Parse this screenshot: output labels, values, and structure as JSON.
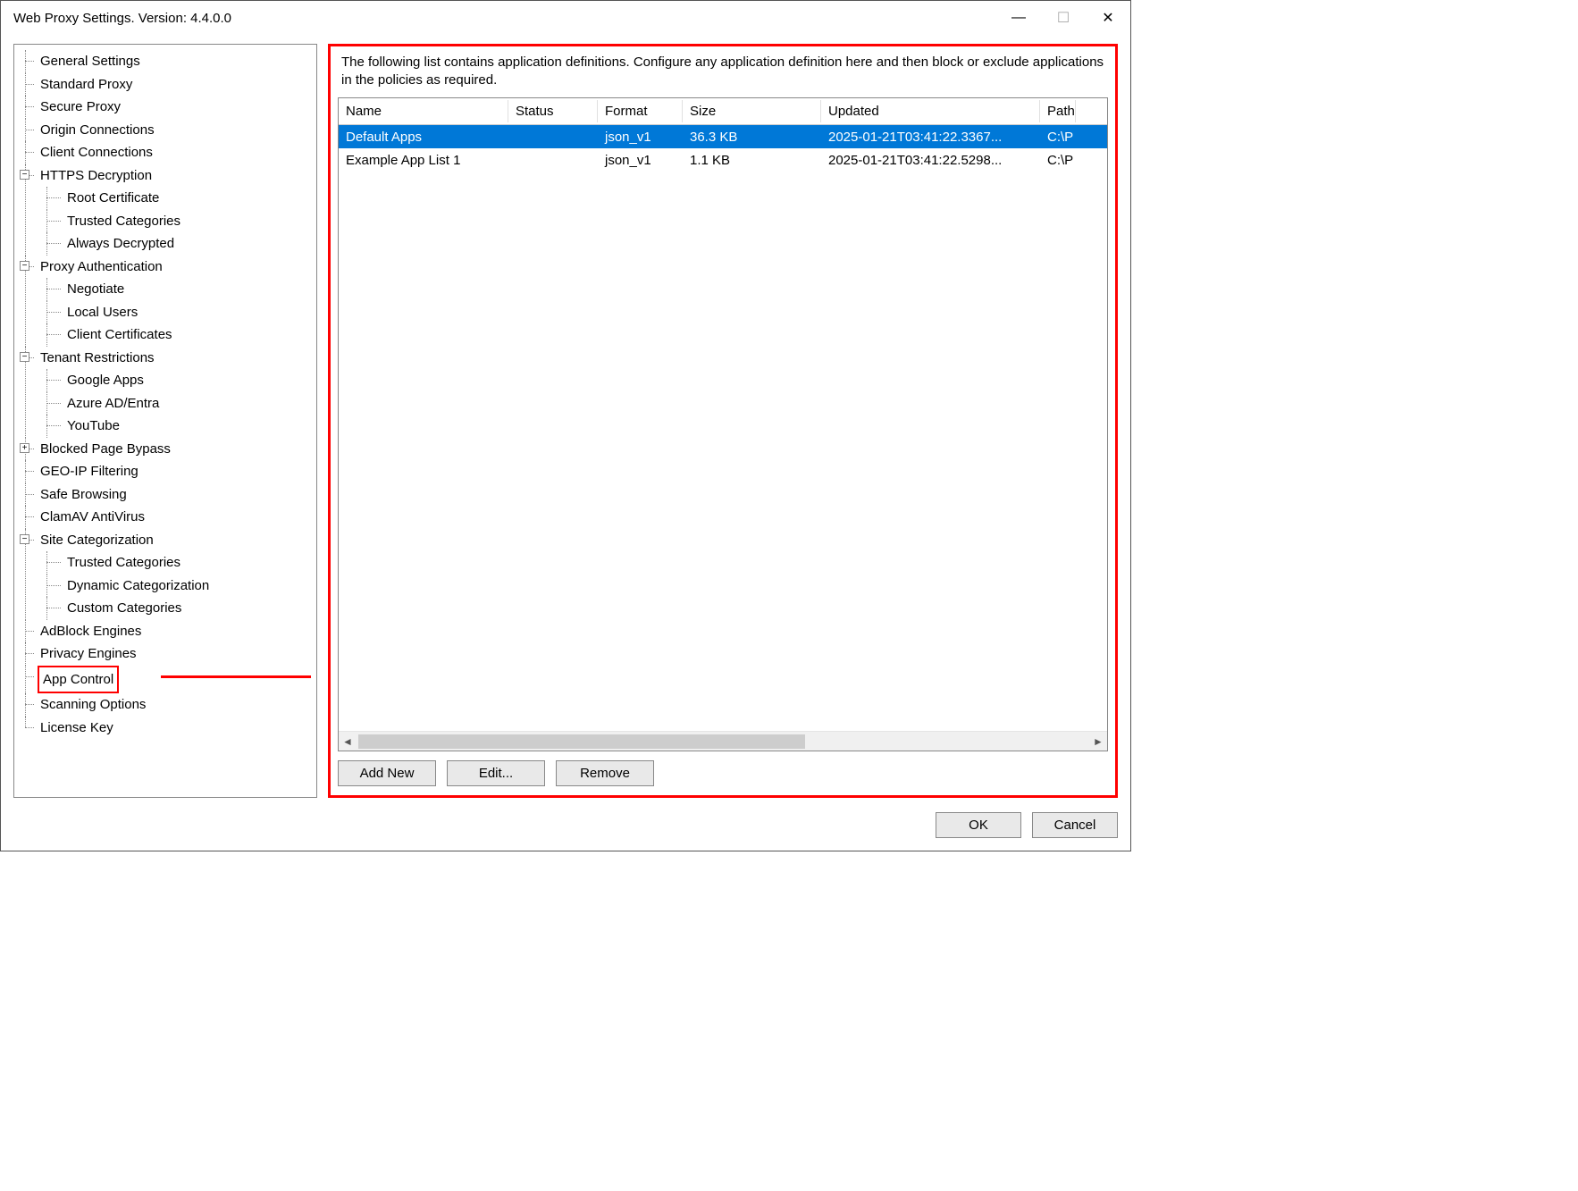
{
  "window": {
    "title": "Web Proxy Settings. Version: 4.4.0.0"
  },
  "tree": {
    "general_settings": "General Settings",
    "standard_proxy": "Standard Proxy",
    "secure_proxy": "Secure Proxy",
    "origin_connections": "Origin Connections",
    "client_connections": "Client Connections",
    "https_decryption": "HTTPS Decryption",
    "root_certificate": "Root Certificate",
    "trusted_categories": "Trusted Categories",
    "always_decrypted": "Always Decrypted",
    "proxy_authentication": "Proxy Authentication",
    "negotiate": "Negotiate",
    "local_users": "Local Users",
    "client_certificates": "Client Certificates",
    "tenant_restrictions": "Tenant Restrictions",
    "google_apps": "Google Apps",
    "azure_ad": "Azure AD/Entra",
    "youtube": "YouTube",
    "blocked_page_bypass": "Blocked Page Bypass",
    "geoip": "GEO-IP Filtering",
    "safe_browsing": "Safe Browsing",
    "clamav": "ClamAV AntiVirus",
    "site_categorization": "Site Categorization",
    "trusted_categories2": "Trusted Categories",
    "dynamic_cat": "Dynamic Categorization",
    "custom_cat": "Custom Categories",
    "adblock": "AdBlock Engines",
    "privacy": "Privacy Engines",
    "app_control": "App Control",
    "scanning": "Scanning Options",
    "license": "License Key"
  },
  "content": {
    "description": "The following list contains application definitions. Configure any application definition here and then block or exclude applications in the policies as required.",
    "columns": {
      "name": "Name",
      "status": "Status",
      "format": "Format",
      "size": "Size",
      "updated": "Updated",
      "path": "Path"
    },
    "rows": [
      {
        "name": "Default Apps",
        "status": "",
        "format": "json_v1",
        "size": "36.3 KB",
        "updated": "2025-01-21T03:41:22.3367...",
        "path": "C:\\P",
        "selected": true
      },
      {
        "name": "Example App List 1",
        "status": "",
        "format": "json_v1",
        "size": "1.1 KB",
        "updated": "2025-01-21T03:41:22.5298...",
        "path": "C:\\P",
        "selected": false
      }
    ],
    "buttons": {
      "add": "Add New",
      "edit": "Edit...",
      "remove": "Remove"
    }
  },
  "dialog": {
    "ok": "OK",
    "cancel": "Cancel"
  },
  "glyph": {
    "minus": "−",
    "plus": "+",
    "close": "✕",
    "max": "☐",
    "min": "—",
    "left": "◄",
    "right": "►"
  }
}
